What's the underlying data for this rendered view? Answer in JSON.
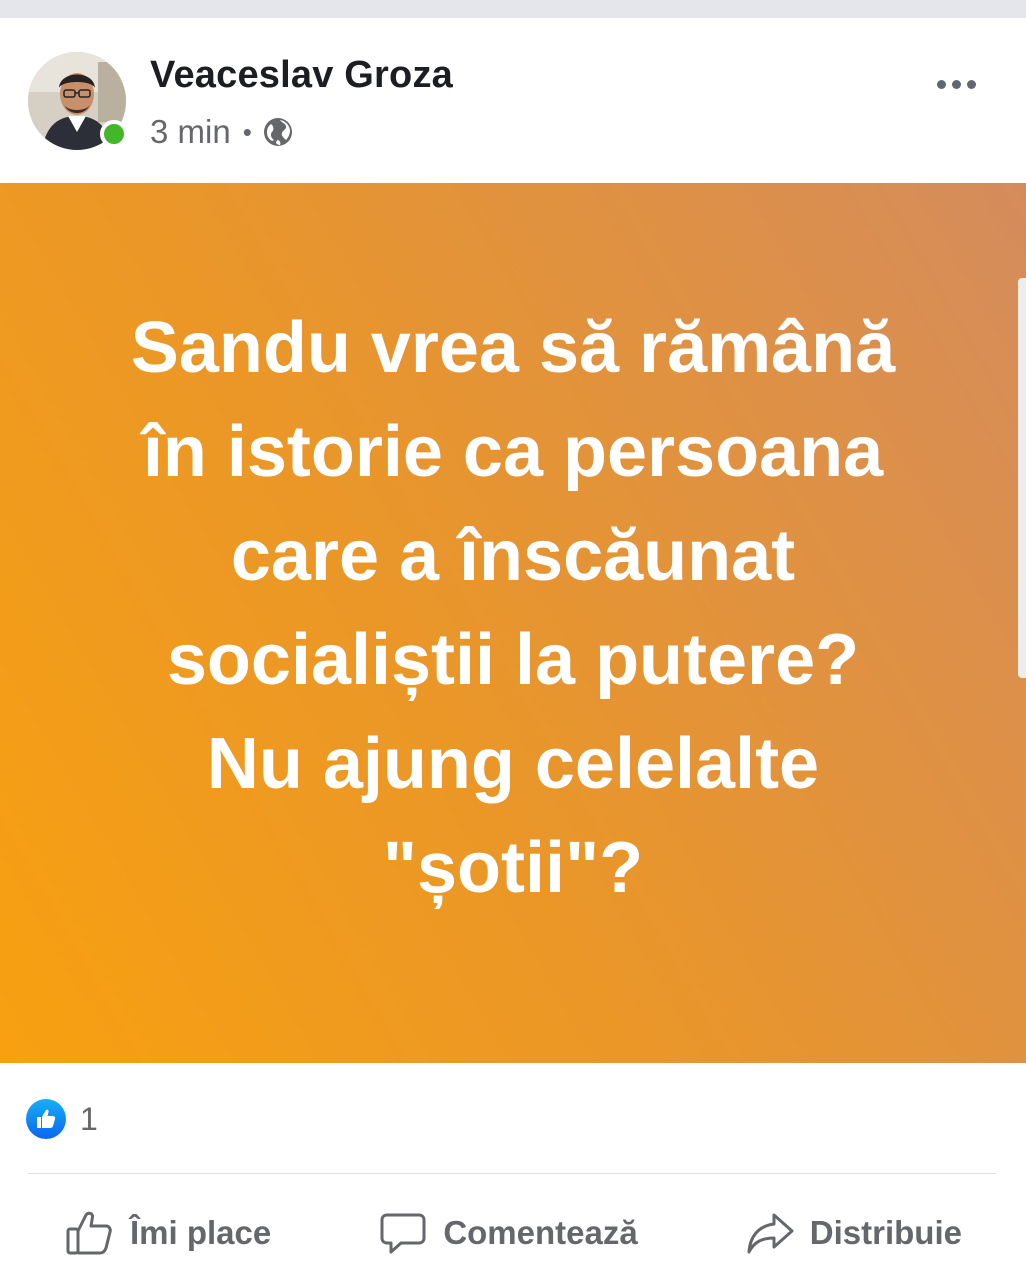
{
  "post": {
    "author": {
      "name": "Veaceslav Groza",
      "online": true
    },
    "timestamp": "3 min",
    "separator": "•",
    "privacy_icon": "globe-icon",
    "more_icon": "more-horizontal-icon",
    "background_colors": [
      "#f8a010",
      "#d58c5c"
    ],
    "text": "Sandu vrea să rămână\nîn istorie ca persoana\ncare a înscăunat\nsocialiștii la putere?\nNu ajung celelalte\n\"șotii\"?"
  },
  "reactions": {
    "icon": "like-reaction-icon",
    "count": "1"
  },
  "actions": {
    "like_label": "Îmi place",
    "comment_label": "Comentează",
    "share_label": "Distribuie"
  },
  "colors": {
    "online": "#42b72a",
    "like_blue": "#0a66f0",
    "secondary_text": "#65676b"
  }
}
